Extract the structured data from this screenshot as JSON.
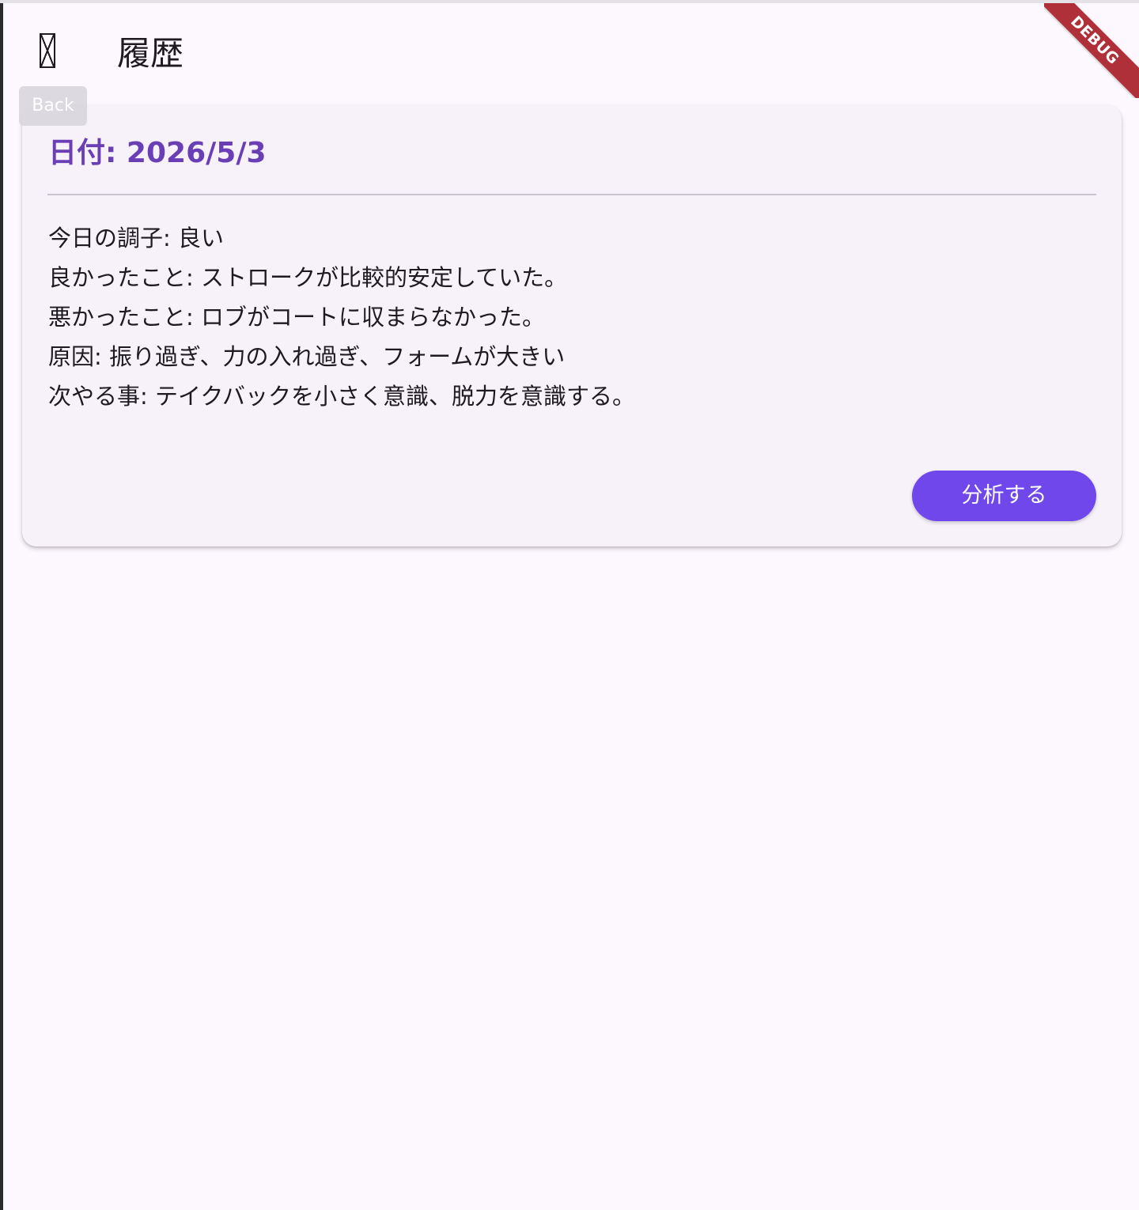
{
  "appbar": {
    "title": "履歴",
    "back_icon": "arrow-back-icon",
    "back_tooltip": "Back"
  },
  "debug_banner": "DEBUG",
  "record": {
    "date_label": "日付: 2026/5/3",
    "lines": [
      "今日の調子: 良い",
      "良かったこと: ストロークが比較的安定していた。",
      "悪かったこと: ロブがコートに収まらなかった。",
      "原因: 振り過ぎ、力の入れ過ぎ、フォームが大きい",
      "次やる事: テイクバックを小さく意識、脱力を意識する。"
    ],
    "analyze_label": "分析する"
  },
  "colors": {
    "background": "#fdf7fe",
    "card": "#f7f2fa",
    "accent": "#7047eb",
    "date_text": "#6a3fb5",
    "debug_ribbon": "#b0303a"
  }
}
